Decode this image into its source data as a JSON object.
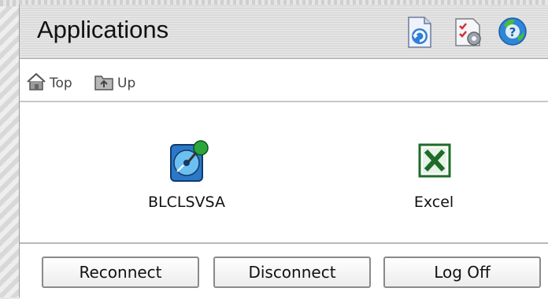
{
  "header": {
    "title": "Applications",
    "icons": [
      "refresh-icon",
      "preferences-icon",
      "help-icon"
    ]
  },
  "nav": {
    "top_label": "Top",
    "up_label": "Up"
  },
  "apps": [
    {
      "label": "BLCLSVSA",
      "icon": "published-disk-pin-icon"
    },
    {
      "label": "Excel",
      "icon": "excel-icon"
    }
  ],
  "footer": {
    "reconnect": "Reconnect",
    "disconnect": "Disconnect",
    "logoff": "Log Off"
  }
}
